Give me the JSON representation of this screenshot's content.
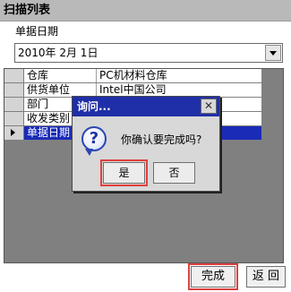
{
  "window": {
    "title": "扫描列表"
  },
  "form": {
    "date_label": "单据日期",
    "date_value": "2010年  2月  1日"
  },
  "grid": {
    "rows": [
      {
        "key": "仓库",
        "value": "PC机材料仓库",
        "selected": false
      },
      {
        "key": "供货单位",
        "value": "Intel中国公司",
        "selected": false
      },
      {
        "key": "部门",
        "value": "",
        "selected": false
      },
      {
        "key": "收发类别",
        "value": "",
        "selected": false
      },
      {
        "key": "单据日期",
        "value": "",
        "selected": true
      }
    ]
  },
  "footer": {
    "finish_label": "完成",
    "back_label": "返 回"
  },
  "dialog": {
    "title": "询问...",
    "close_glyph": "✕",
    "icon_glyph": "?",
    "message": "你确认要完成吗?",
    "yes_label": "是",
    "no_label": "否"
  },
  "colors": {
    "titlebar": "#b9b9b9",
    "selection": "#1a2bb8",
    "dialog_title": "#1f2fa8",
    "focus_outline": "#e04040",
    "grid_background": "#808080"
  }
}
